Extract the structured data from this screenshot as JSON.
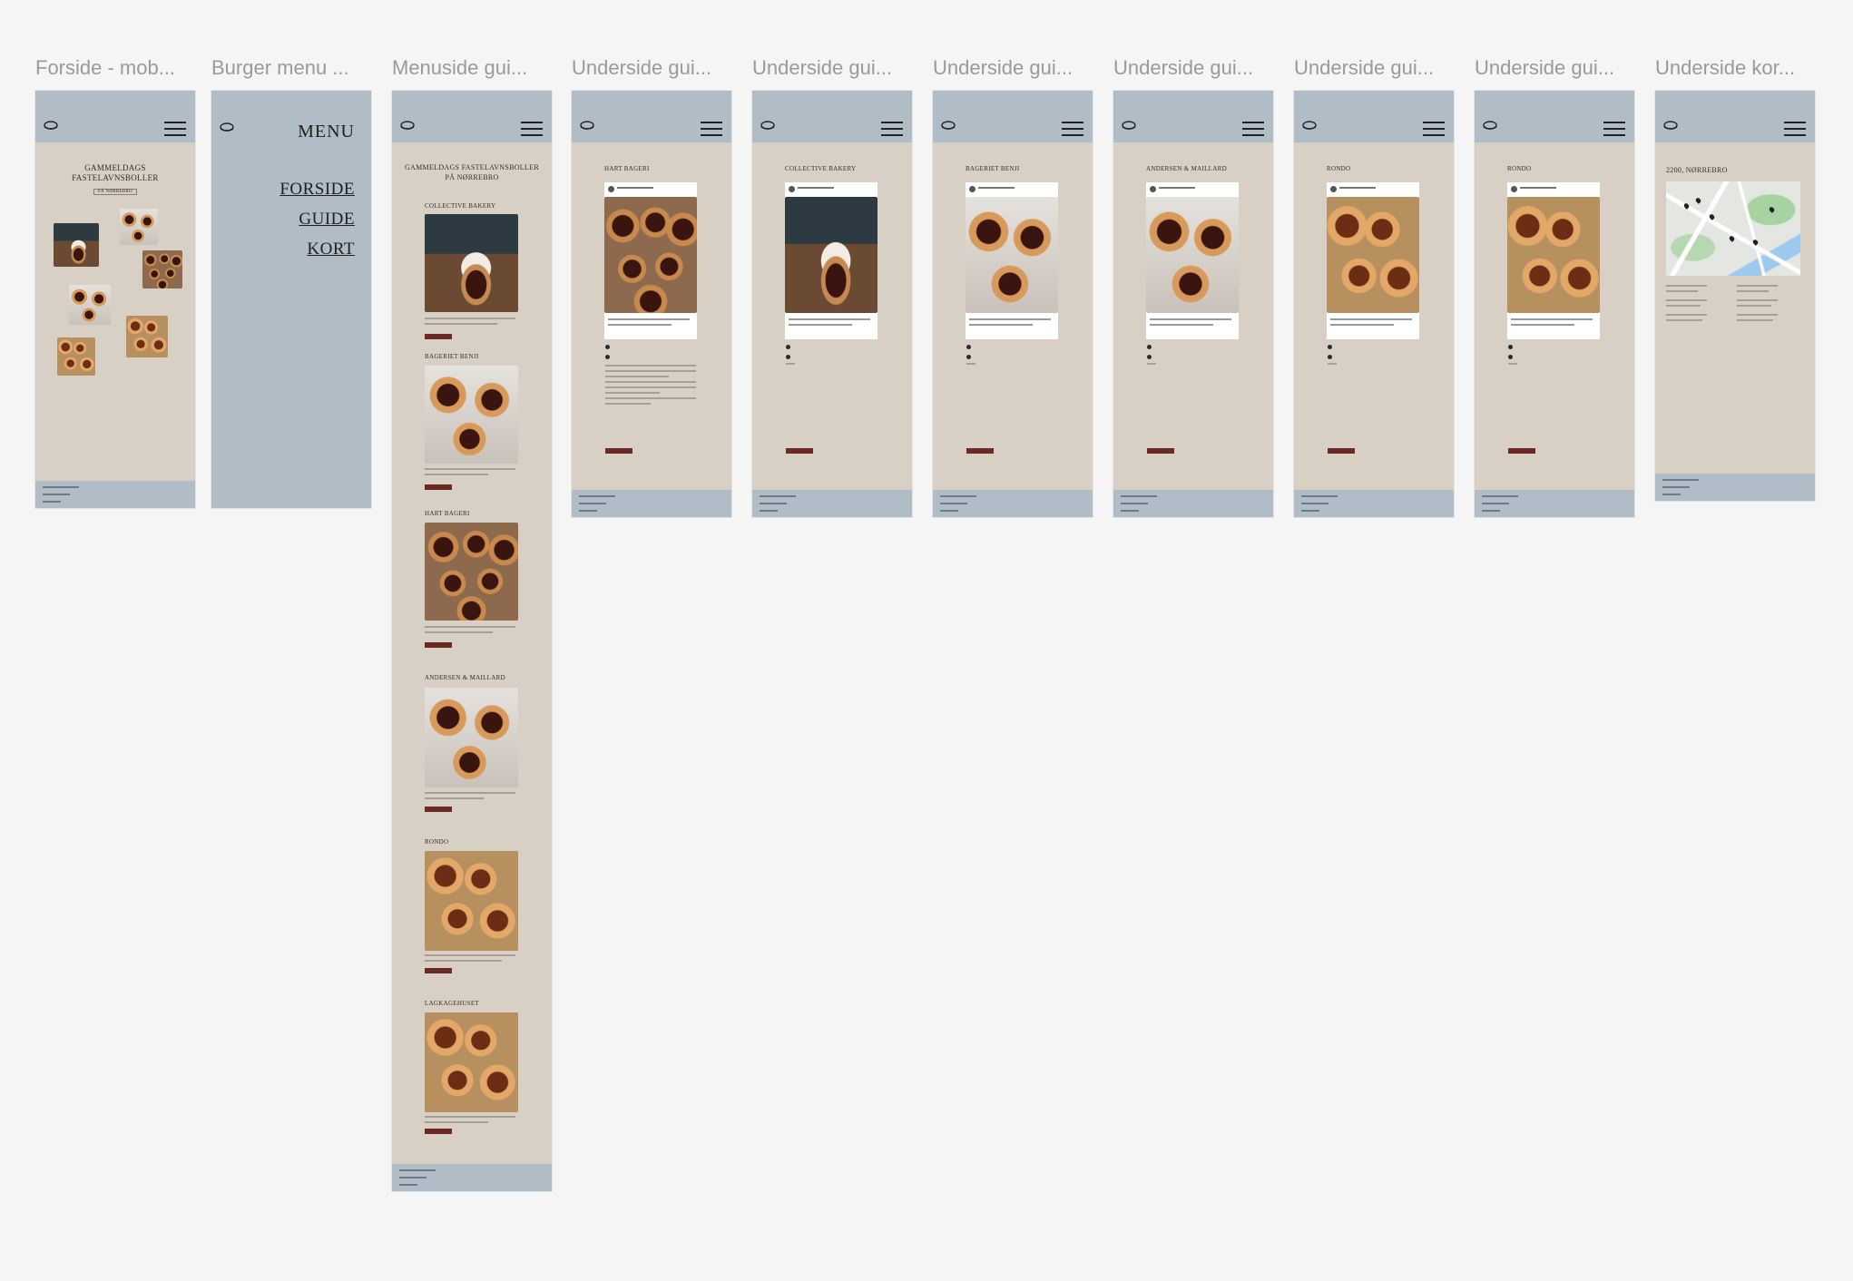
{
  "frames": [
    {
      "label": "Forside - mob...",
      "key": "forside"
    },
    {
      "label": "Burger menu ...",
      "key": "burger"
    },
    {
      "label": "Menuside gui...",
      "key": "menuside"
    },
    {
      "label": "Underside gui...",
      "key": "hart"
    },
    {
      "label": "Underside gui...",
      "key": "collective"
    },
    {
      "label": "Underside gui...",
      "key": "benji"
    },
    {
      "label": "Underside gui...",
      "key": "andersen"
    },
    {
      "label": "Underside gui...",
      "key": "rondo1"
    },
    {
      "label": "Underside gui...",
      "key": "rondo2"
    },
    {
      "label": "Underside kor...",
      "key": "kort"
    }
  ],
  "forside": {
    "title_line1": "GAMMELDAGS",
    "title_line2": "FASTELAVNSBOLLER",
    "subtitle": "PÅ NØRREBRO"
  },
  "burger_menu": {
    "title": "MENU",
    "links": [
      "FORSIDE",
      "GUIDE",
      "KORT"
    ]
  },
  "menuside": {
    "title_line1": "GAMMELDAGS FASTELAVNSBOLLER",
    "title_line2": "PÅ NØRREBRO",
    "sections": [
      "COLLECTIVE BAKERY",
      "BAGERIET BENJI",
      "HART BAGERI",
      "ANDERSEN & MAILLARD",
      "RONDO",
      "LAGKAGEHUSET"
    ]
  },
  "underside": {
    "hart": "HART BAGERI",
    "collective": "COLLECTIVE BAKERY",
    "benji": "BAGERIET BENJI",
    "andersen": "ANDERSEN & MAILLARD",
    "rondo1": "RONDO",
    "rondo2": "RONDO"
  },
  "kort": {
    "title": "2200, NØRREBRO"
  },
  "colors": {
    "canvas": "#f5f5f5",
    "header": "#b1bdc6",
    "page": "#d8d0c4",
    "accent_button": "#6b2a25"
  },
  "icons": [
    "pastry-logo-icon",
    "hamburger-menu-icon"
  ]
}
